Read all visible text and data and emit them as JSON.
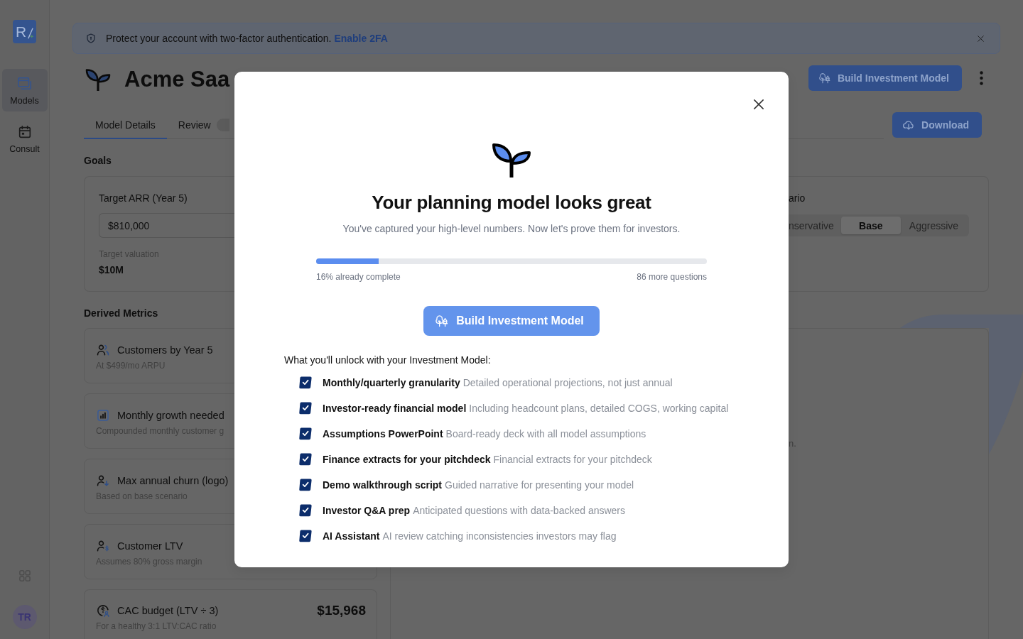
{
  "sidebar": {
    "logo": "R",
    "items": [
      {
        "label": "Models",
        "selected": true
      },
      {
        "label": "Consult",
        "selected": false
      }
    ],
    "avatar": "TR"
  },
  "banner": {
    "message": "Protect your account with two-factor authentication.",
    "link": "Enable 2FA"
  },
  "header": {
    "title": "Acme Saa",
    "button": "Build Investment Model"
  },
  "tabs": [
    {
      "label": "Model Details",
      "selected": true,
      "badge": false
    },
    {
      "label": "Review",
      "selected": false,
      "badge": true
    }
  ],
  "download_button": "Download",
  "goals": {
    "heading": "Goals",
    "target": {
      "label": "Target ARR (Year 5)",
      "value": "$810,000",
      "valuation_label": "Target valuation",
      "valuation": "$10M"
    },
    "scenario": {
      "label": "ario",
      "options": [
        {
          "label": "nservative",
          "selected": false
        },
        {
          "label": "Base",
          "selected": true
        },
        {
          "label": "Aggressive",
          "selected": false
        }
      ]
    }
  },
  "derived_metrics": {
    "heading": "Derived Metrics",
    "cards": [
      {
        "title": "Customers by Year 5",
        "subtitle": "At $499/mo ARPU"
      },
      {
        "title": "Monthly growth needed",
        "subtitle": "Compounded monthly customer g"
      },
      {
        "title": "Max annual churn (logo)",
        "subtitle": "Based on base scenario"
      },
      {
        "title": "Customer LTV",
        "subtitle": "Assumes 80% gross margin"
      },
      {
        "title": "CAC budget (LTV ÷ 3)",
        "subtitle": "For a healthy 3:1 LTV:CAC ratio",
        "value": "$15,968"
      }
    ]
  },
  "panel": {
    "text": "n."
  },
  "modal": {
    "title": "Your planning model looks great",
    "subtitle": "You've captured your high-level numbers. Now let's prove them for investors.",
    "progress": {
      "level": 0.16,
      "done_label": "16% already complete",
      "remaining_label": "86 more questions"
    },
    "button": "Build Investment Model",
    "unlock_heading": "What you'll unlock with your Investment Model:",
    "unlock_items": [
      {
        "title": "Monthly/quarterly granularity",
        "description": "Detailed operational projections, not just annual",
        "checked": true
      },
      {
        "title": "Investor-ready financial model",
        "description": "Including headcount plans, detailed COGS, working capital",
        "checked": true
      },
      {
        "title": "Assumptions PowerPoint",
        "description": "Board-ready deck with all model assumptions",
        "checked": true
      },
      {
        "title": "Finance extracts for your pitchdeck",
        "description": "Financial extracts for your pitchdeck",
        "checked": true
      },
      {
        "title": "Demo walkthrough script",
        "description": "Guided narrative for presenting your model",
        "checked": true
      },
      {
        "title": "Investor Q&A prep",
        "description": "Anticipated questions with data-backed answers",
        "checked": true
      },
      {
        "title": "AI Assistant",
        "description": "AI review catching inconsistencies investors may flag",
        "checked": true
      }
    ]
  }
}
